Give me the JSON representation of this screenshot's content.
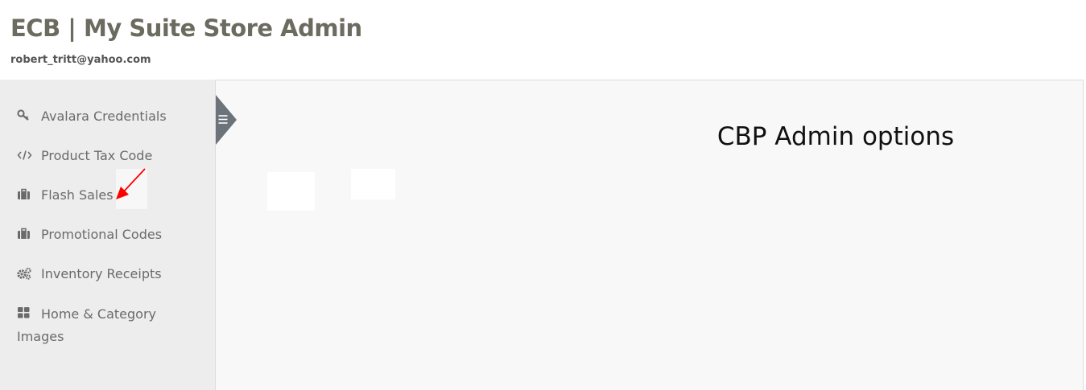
{
  "header": {
    "title": "ECB | My Suite Store Admin",
    "email": "robert_tritt@yahoo.com"
  },
  "sidebar": {
    "items": [
      {
        "label": "Avalara Credentials",
        "icon": "key-icon"
      },
      {
        "label": "Product Tax Code",
        "icon": "code-icon"
      },
      {
        "label": "Flash Sales",
        "icon": "briefcase-icon"
      },
      {
        "label": "Promotional Codes",
        "icon": "briefcase-icon"
      },
      {
        "label": "Inventory Receipts",
        "icon": "gears-icon"
      },
      {
        "label": "Home & Category Images",
        "icon": "grid-icon"
      }
    ]
  },
  "main": {
    "title": "CBP Admin options"
  },
  "colors": {
    "title": "#6b6b60",
    "sidebar_bg": "#ededed",
    "main_bg": "#f8f8f8",
    "toggle": "#6d737b",
    "annotation_arrow": "#ff0000"
  }
}
